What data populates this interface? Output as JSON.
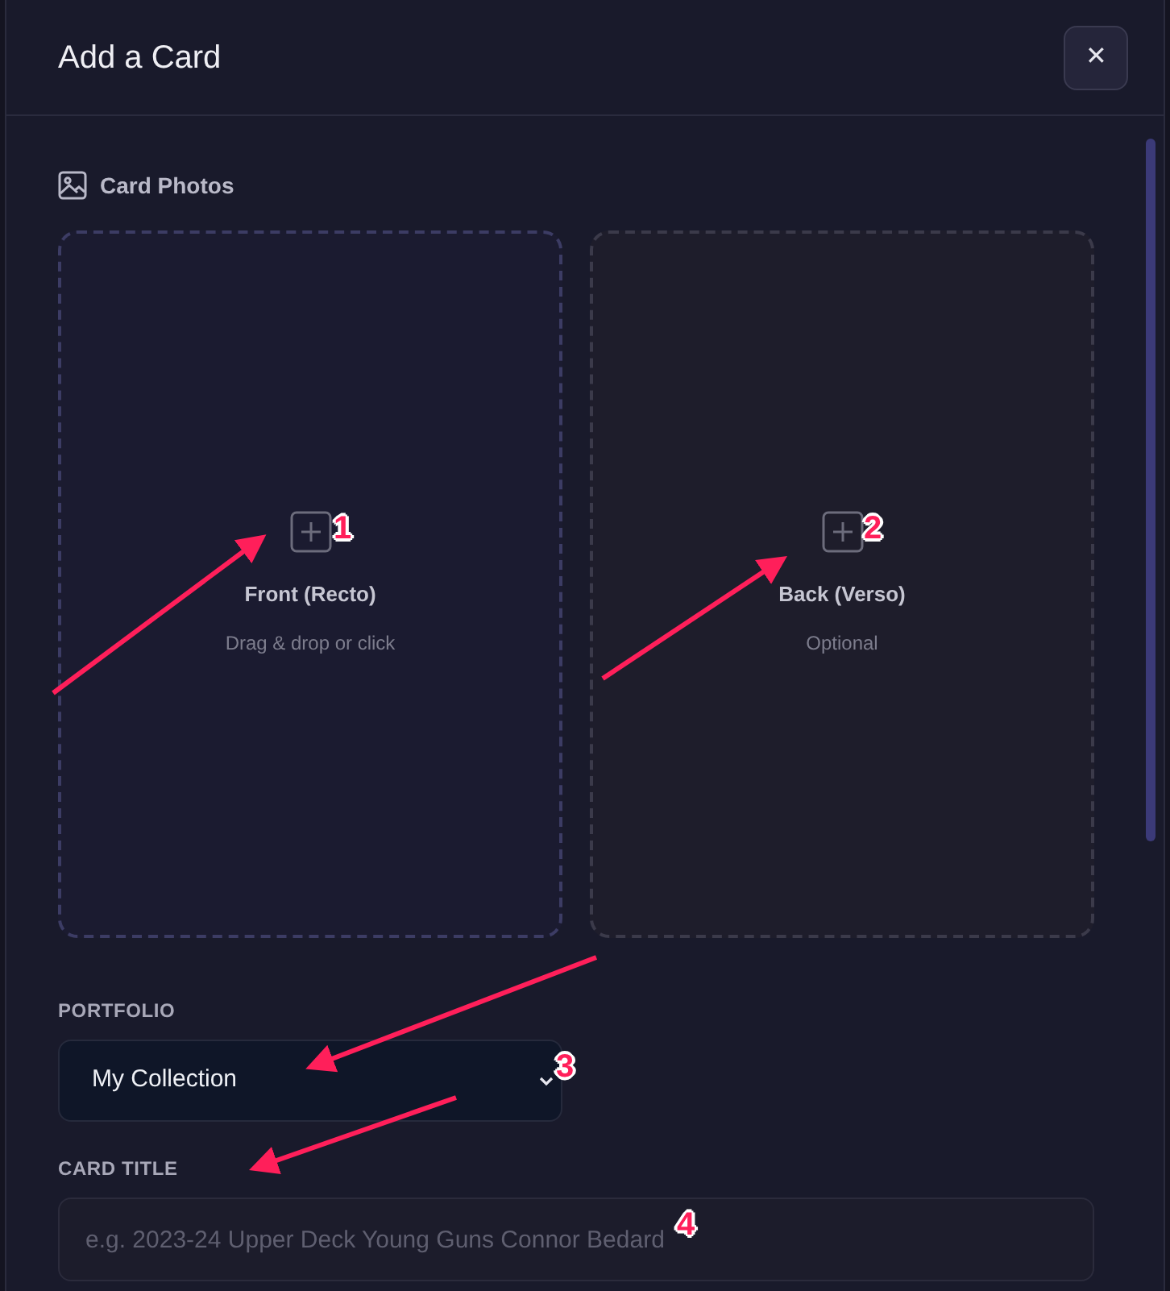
{
  "dialog": {
    "title": "Add a Card",
    "close_label": "✕"
  },
  "photos": {
    "heading": "Card Photos",
    "slots": [
      {
        "label": "Front (Recto)",
        "hint": "Drag & drop or click"
      },
      {
        "label": "Back (Verso)",
        "hint": "Optional"
      }
    ]
  },
  "portfolio": {
    "label": "PORTFOLIO",
    "value": "My Collection"
  },
  "card_title": {
    "label": "CARD TITLE",
    "placeholder": "e.g. 2023-24 Upper Deck Young Guns Connor Bedard"
  },
  "annotations": [
    {
      "label": "1"
    },
    {
      "label": "2"
    },
    {
      "label": "3"
    },
    {
      "label": "4"
    }
  ]
}
